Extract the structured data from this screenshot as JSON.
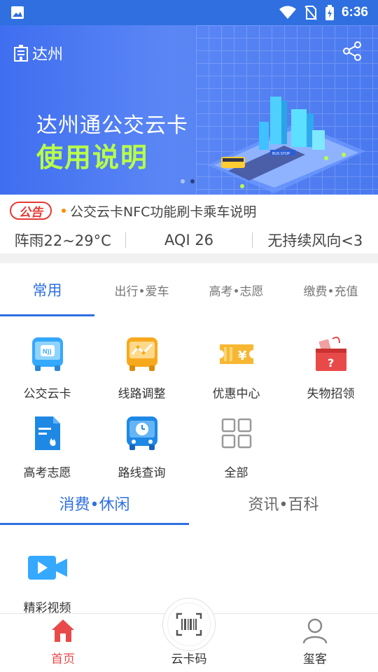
{
  "status_bar": {
    "time": "6:36"
  },
  "header": {
    "city": "达州"
  },
  "banner": {
    "title": "达州通公交云卡",
    "subtitle": "使用说明",
    "bus_stop_sign": "BUS STOP"
  },
  "notice": {
    "tag": "公告",
    "text": "公交云卡NFC功能刷卡乘车说明"
  },
  "weather": {
    "condition_temp": "阵雨22~29°C",
    "aqi": "AQI   26",
    "wind": "无持续风向<3"
  },
  "service_tabs": [
    "常用",
    "出行•爱车",
    "高考•志愿",
    "缴费•充值"
  ],
  "services": [
    {
      "label": "公交云卡",
      "icon": "bus-nfc-icon"
    },
    {
      "label": "线路调整",
      "icon": "route-adjust-icon"
    },
    {
      "label": "优惠中心",
      "icon": "coupon-icon"
    },
    {
      "label": "失物招领",
      "icon": "lost-found-icon"
    },
    {
      "label": "高考志愿",
      "icon": "exam-doc-icon"
    },
    {
      "label": "路线查询",
      "icon": "bus-clock-icon"
    },
    {
      "label": "全部",
      "icon": "all-grid-icon"
    }
  ],
  "leisure_tabs": [
    "消费•休闲",
    "资讯•百科"
  ],
  "leisure_items": [
    {
      "label": "精彩视频",
      "icon": "video-camera-icon"
    }
  ],
  "bottom_nav": {
    "home": "首页",
    "card_code": "云卡码",
    "profile": "玺客"
  },
  "colors": {
    "primary": "#2f6fe0",
    "accent_red": "#e84a4a",
    "banner_green": "#b8ff4a"
  }
}
